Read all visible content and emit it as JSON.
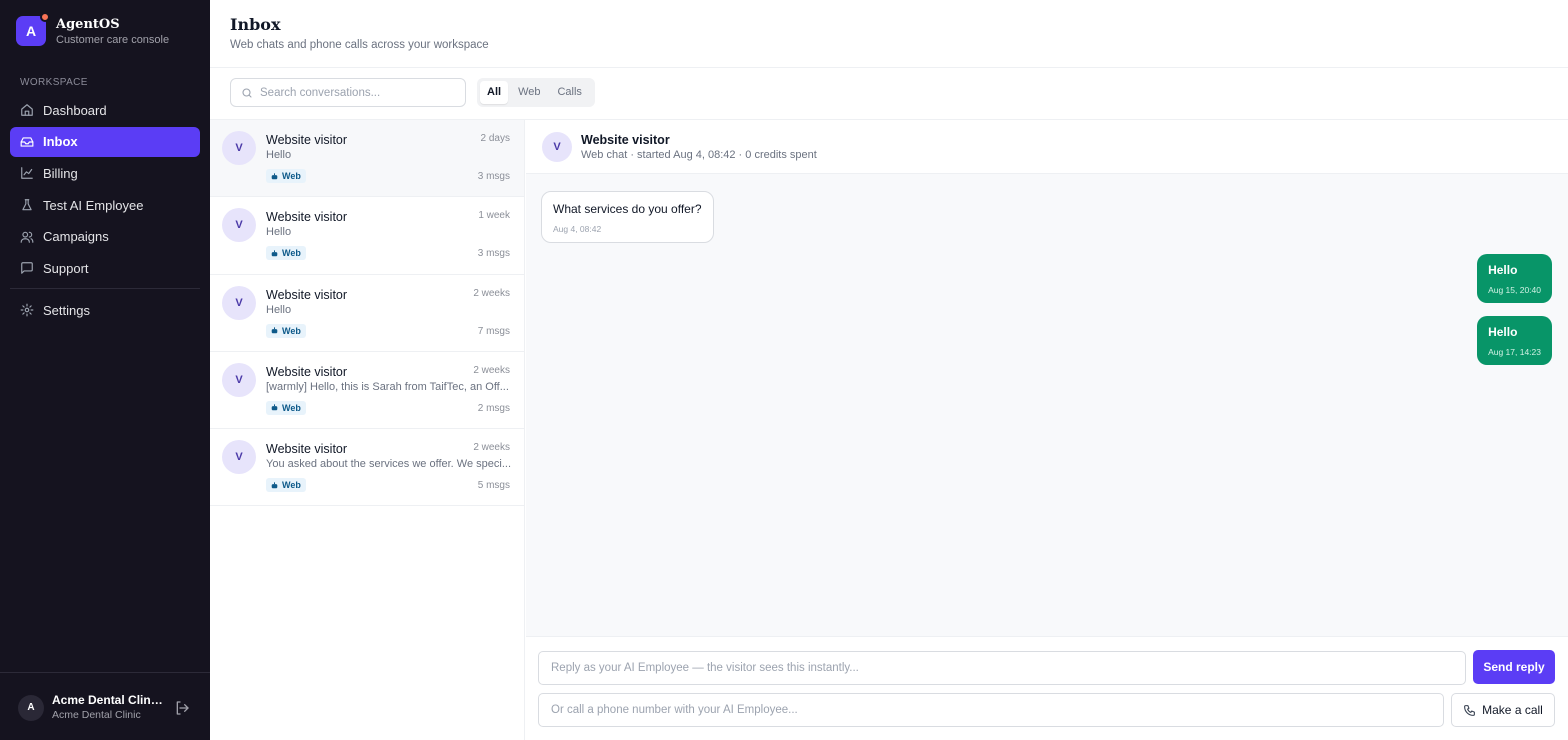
{
  "brand": {
    "initial": "A",
    "name": "AgentOS",
    "subtitle": "Customer care console"
  },
  "sidebar": {
    "section_label": "WORKSPACE",
    "items": [
      {
        "label": "Dashboard",
        "icon": "home-icon",
        "active": false
      },
      {
        "label": "Inbox",
        "icon": "inbox-icon",
        "active": true
      },
      {
        "label": "Billing",
        "icon": "chart-line-icon",
        "active": false
      },
      {
        "label": "Test AI Employee",
        "icon": "flask-icon",
        "active": false
      },
      {
        "label": "Campaigns",
        "icon": "users-icon",
        "active": false
      },
      {
        "label": "Support",
        "icon": "message-square-icon",
        "active": false
      }
    ],
    "settings_label": "Settings"
  },
  "account": {
    "initial": "A",
    "name": "Acme Dental Clinic...",
    "org": "Acme Dental Clinic"
  },
  "header": {
    "title": "Inbox",
    "subtitle": "Web chats and phone calls across your workspace"
  },
  "toolbar": {
    "search_placeholder": "Search conversations...",
    "filters": [
      {
        "label": "All",
        "active": true
      },
      {
        "label": "Web",
        "active": false
      },
      {
        "label": "Calls",
        "active": false
      }
    ]
  },
  "conversations": [
    {
      "initial": "V",
      "name": "Website visitor",
      "time": "2 days",
      "preview": "Hello",
      "channel": "Web",
      "count": "3 msgs",
      "selected": true
    },
    {
      "initial": "V",
      "name": "Website visitor",
      "time": "1 week",
      "preview": "Hello",
      "channel": "Web",
      "count": "3 msgs",
      "selected": false
    },
    {
      "initial": "V",
      "name": "Website visitor",
      "time": "2 weeks",
      "preview": "Hello",
      "channel": "Web",
      "count": "7 msgs",
      "selected": false
    },
    {
      "initial": "V",
      "name": "Website visitor",
      "time": "2 weeks",
      "preview": "[warmly] Hello, this is Sarah from TaifTec, an Off...",
      "channel": "Web",
      "count": "2 msgs",
      "selected": false
    },
    {
      "initial": "V",
      "name": "Website visitor",
      "time": "2 weeks",
      "preview": "You asked about the services we offer. We speci...",
      "channel": "Web",
      "count": "5 msgs",
      "selected": false
    }
  ],
  "chat": {
    "initial": "V",
    "title": "Website visitor",
    "meta": "Web chat · started Aug 4, 08:42 · 0 credits spent",
    "messages": [
      {
        "direction": "in",
        "text": "What services do you offer?",
        "time": "Aug 4, 08:42"
      },
      {
        "direction": "out",
        "text": "Hello",
        "time": "Aug 15, 20:40"
      },
      {
        "direction": "out",
        "text": "Hello",
        "time": "Aug 17, 14:23"
      }
    ]
  },
  "composer": {
    "reply_placeholder": "Reply as your AI Employee — the visitor sees this instantly...",
    "send_label": "Send reply",
    "call_placeholder": "Or call a phone number with your AI Employee...",
    "call_label": "Make a call"
  },
  "colors": {
    "accent": "#5b3df5",
    "sidebar_bg": "#15131f",
    "outgoing_bubble": "#089568",
    "notification_dot": "#f97356",
    "web_badge_bg": "#e8f3fb"
  }
}
